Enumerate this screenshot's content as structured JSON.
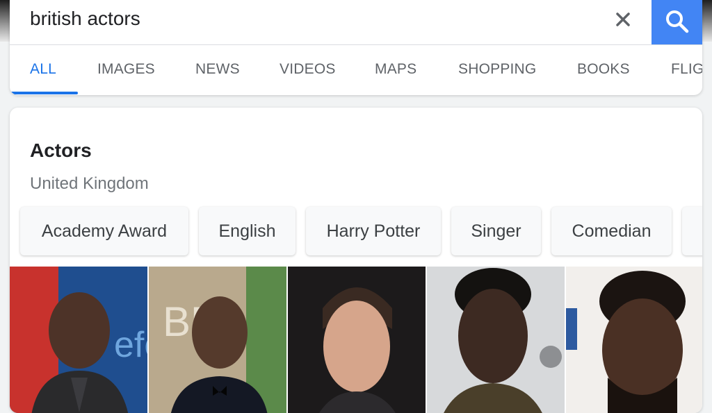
{
  "search": {
    "query": "british actors"
  },
  "tabs": [
    {
      "label": "ALL",
      "active": true
    },
    {
      "label": "IMAGES"
    },
    {
      "label": "NEWS"
    },
    {
      "label": "VIDEOS"
    },
    {
      "label": "MAPS"
    },
    {
      "label": "SHOPPING"
    },
    {
      "label": "BOOKS"
    },
    {
      "label": "FLIG"
    }
  ],
  "card": {
    "title": "Actors",
    "subtitle": "United Kingdom",
    "chips": [
      "Academy Award",
      "English",
      "Harry Potter",
      "Singer",
      "Comedian"
    ],
    "photos": [
      "actor-photo-1",
      "actor-photo-2",
      "actor-photo-3",
      "actor-photo-4",
      "actor-photo-5"
    ]
  },
  "colors": {
    "accent": "#1a73e8",
    "search_button": "#4285f4",
    "text": "#202124",
    "muted": "#70757a"
  }
}
